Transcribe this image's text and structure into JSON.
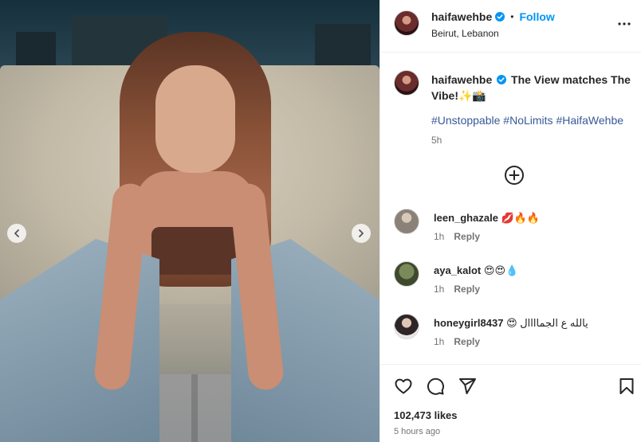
{
  "post": {
    "username": "haifawehbe",
    "verified": true,
    "separator": "•",
    "follow_label": "Follow",
    "location": "Beirut, Lebanon",
    "caption_text": "The View matches The Vibe!✨📸",
    "hashtags": [
      "#Unstoppable",
      "#NoLimits",
      "#HaifaWehbe"
    ],
    "caption_time": "5h",
    "likes": "102,473 likes",
    "posted_ago": "5 hours ago"
  },
  "comments": [
    {
      "username": "leen_ghazale",
      "text": "💋🔥🔥",
      "time": "1h",
      "reply_label": "Reply"
    },
    {
      "username": "aya_kalot",
      "text": "😍😍💧",
      "time": "1h",
      "reply_label": "Reply"
    },
    {
      "username": "honeygirl8437",
      "text": "😍 يالله ع الجماااال",
      "time": "1h",
      "reply_label": "Reply"
    }
  ],
  "icons": {
    "verified": "verified-badge-icon",
    "more": "more-options-icon",
    "add_comment": "plus-circle-icon",
    "like": "heart-icon",
    "comment": "comment-bubble-icon",
    "share": "paper-plane-icon",
    "save": "bookmark-icon",
    "prev": "chevron-left-icon",
    "next": "chevron-right-icon"
  },
  "colors": {
    "accent": "#0095f6",
    "text": "#262626",
    "muted": "#737373",
    "hashtag": "#4a6fa5"
  }
}
